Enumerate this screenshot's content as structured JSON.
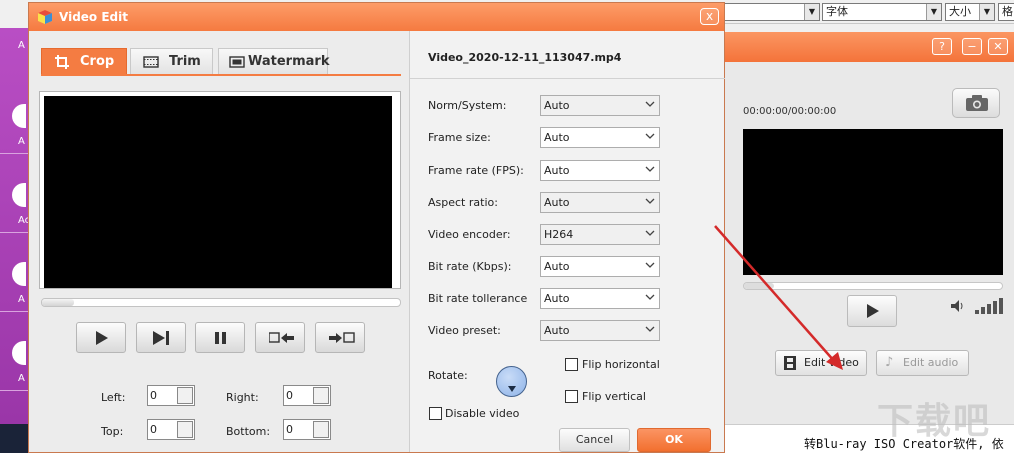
{
  "background_app": {
    "toolbar": {
      "combo1_value": "",
      "combo2_value": "字体",
      "combo3_value": "大小",
      "combo4_value": "格"
    },
    "left_title_fragment": "A",
    "left_tiles": [
      "A",
      "Ac",
      "A",
      "A"
    ],
    "window_buttons": {
      "help": "?",
      "minimize": "−",
      "close": "✕"
    },
    "time_display": "00:00:00/00:00:00",
    "edit_video_label": "Edit video",
    "edit_audio_label": "Edit audio",
    "bottom_text": "转Blu-ray ISO Creator软件, 依",
    "watermark_text": "下载吧"
  },
  "dialog": {
    "title": "Video Edit",
    "close_label": "x",
    "tabs": [
      {
        "label": "Crop",
        "active": true,
        "icon": "crop-icon"
      },
      {
        "label": "Trim",
        "active": false,
        "icon": "film-strip-icon"
      },
      {
        "label": "Watermark",
        "active": false,
        "icon": "watermark-icon"
      }
    ],
    "crop": {
      "left_label": "Left:",
      "left_value": "0",
      "right_label": "Right:",
      "right_value": "0",
      "top_label": "Top:",
      "top_value": "0",
      "bottom_label": "Bottom:",
      "bottom_value": "0"
    },
    "controls": [
      "play-icon",
      "next-frame-icon",
      "pause-icon",
      "mark-in-icon",
      "mark-out-icon"
    ],
    "file_name": "Video_2020-12-11_113047.mp4",
    "settings": [
      {
        "label": "Norm/System:",
        "value": "Auto"
      },
      {
        "label": "Frame size:",
        "value": "Auto"
      },
      {
        "label": "Frame rate (FPS):",
        "value": "Auto"
      },
      {
        "label": "Aspect ratio:",
        "value": "Auto"
      },
      {
        "label": "Video encoder:",
        "value": "H264"
      },
      {
        "label": "Bit rate (Kbps):",
        "value": "Auto"
      },
      {
        "label": "Bit rate tollerance",
        "value": "Auto"
      },
      {
        "label": "Video preset:",
        "value": "Auto"
      }
    ],
    "rotate_label": "Rotate:",
    "flip_horizontal_label": "Flip horizontal",
    "flip_vertical_label": "Flip vertical",
    "disable_video_label": "Disable video",
    "cancel_label": "Cancel",
    "ok_label": "OK"
  },
  "colors": {
    "accent_orange": "#f47c42",
    "annotation_red": "#d42a2a",
    "left_rail_purple": "#b94ec4"
  }
}
